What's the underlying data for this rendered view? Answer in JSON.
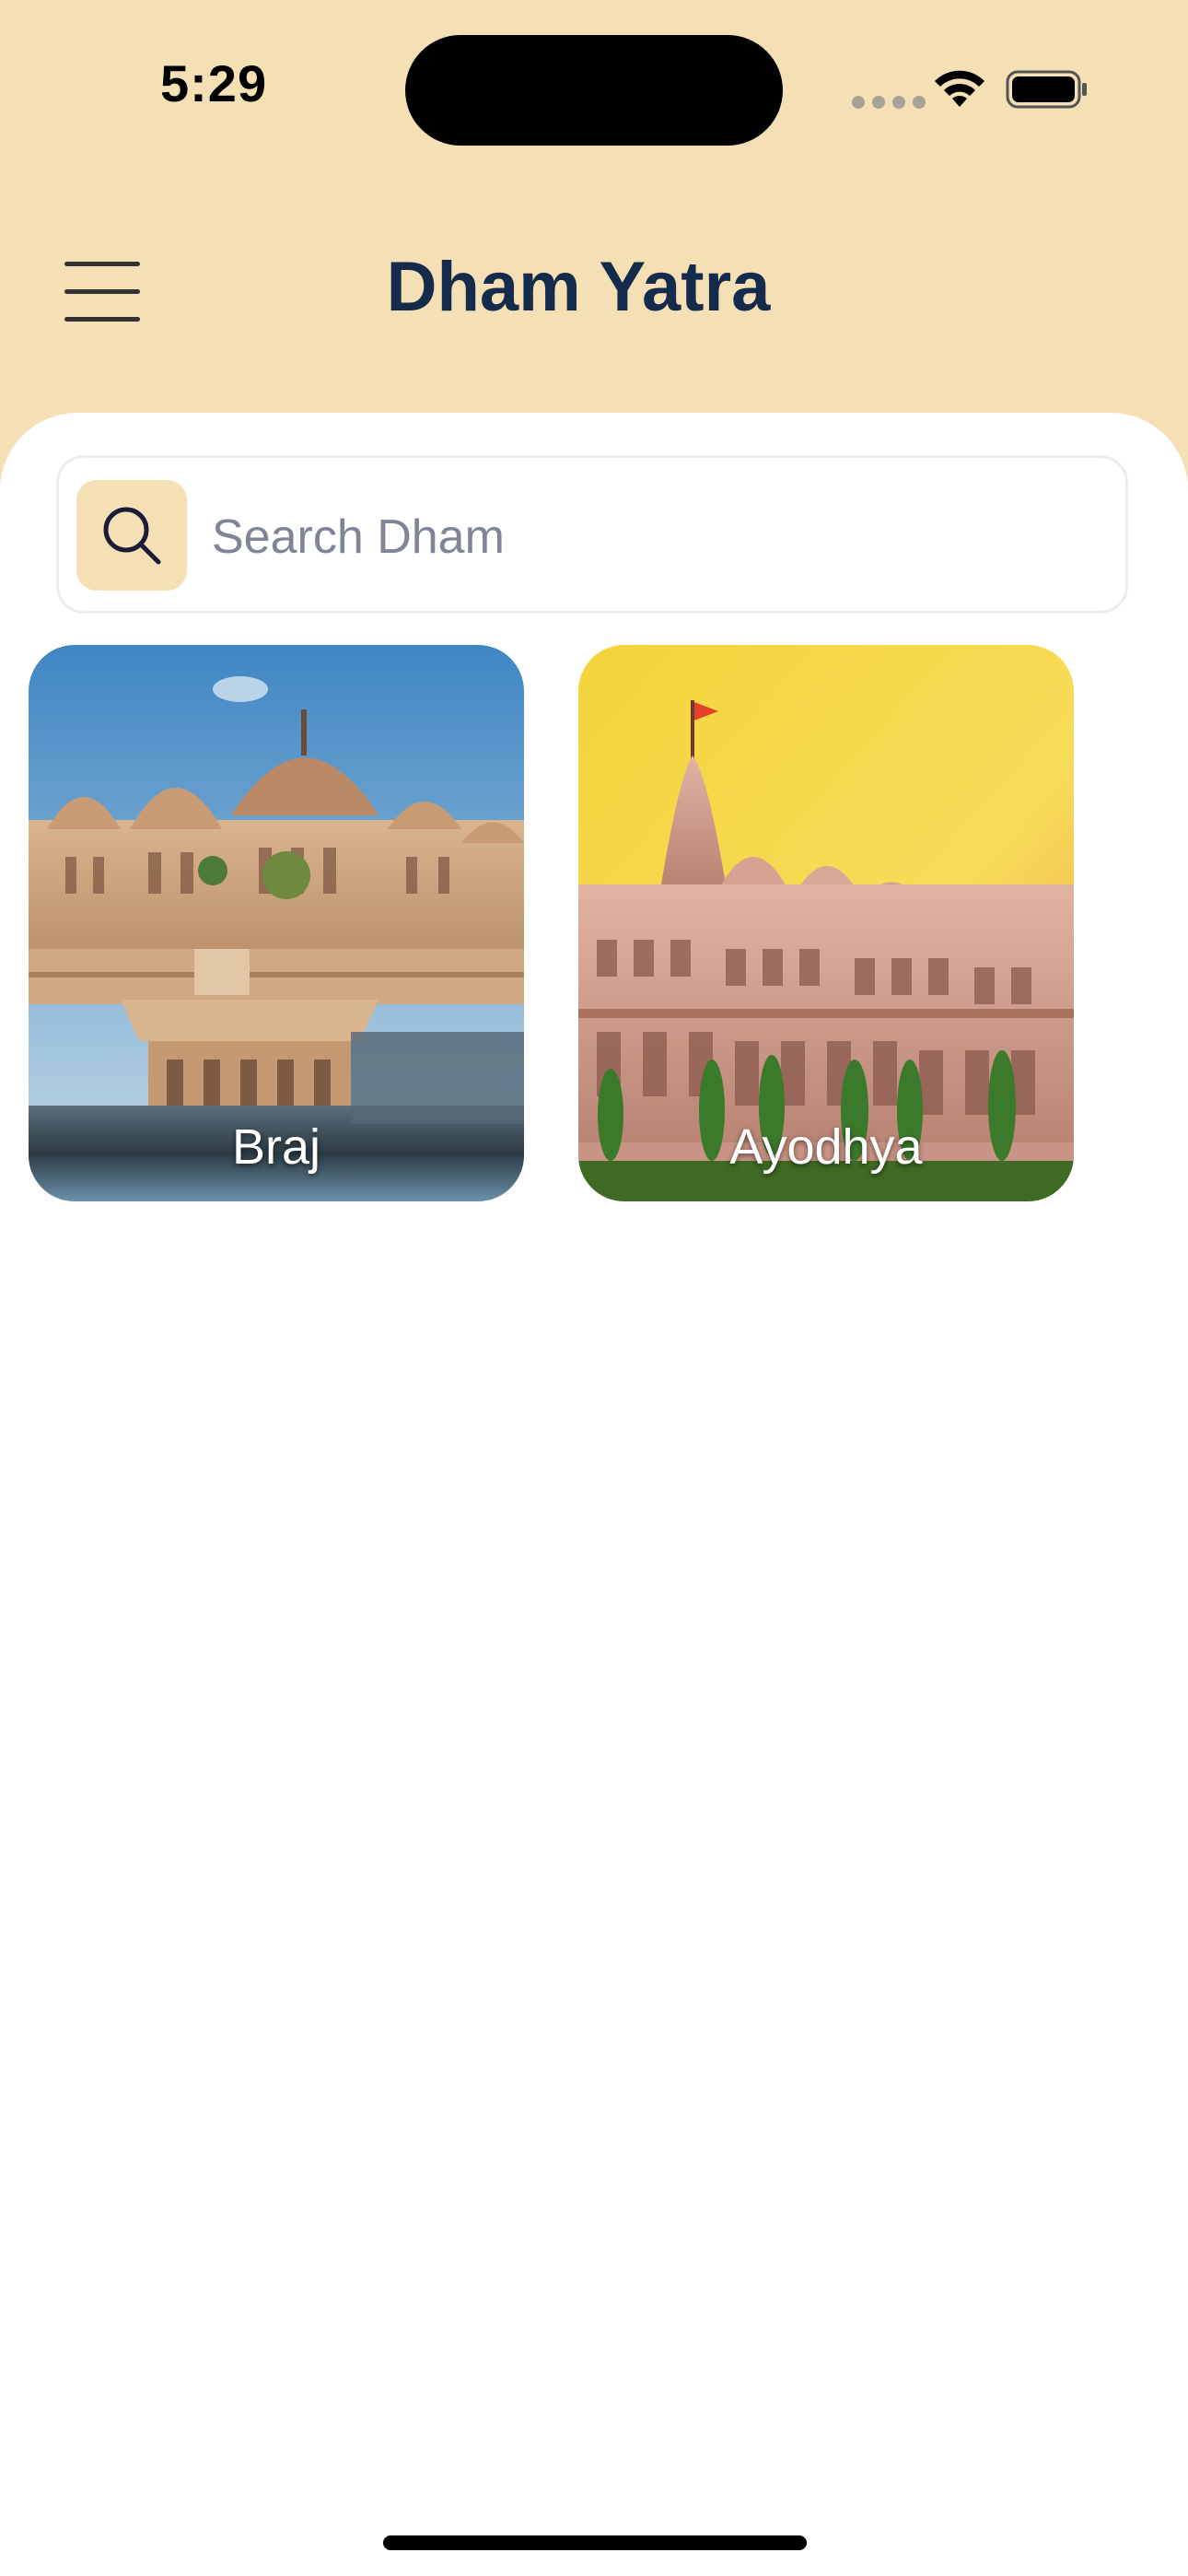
{
  "status_bar": {
    "time": "5:29"
  },
  "header": {
    "title": "Dham Yatra",
    "menu_icon": "hamburger-menu-icon"
  },
  "search": {
    "placeholder": "Search Dham",
    "value": "",
    "icon": "search-icon"
  },
  "dhams": [
    {
      "label": "Braj"
    },
    {
      "label": "Ayodhya"
    }
  ],
  "colors": {
    "header_background": "#f5e0b5",
    "title_text": "#142b4c",
    "search_tile": "#f5e0b5",
    "placeholder_text": "#7f8596"
  }
}
